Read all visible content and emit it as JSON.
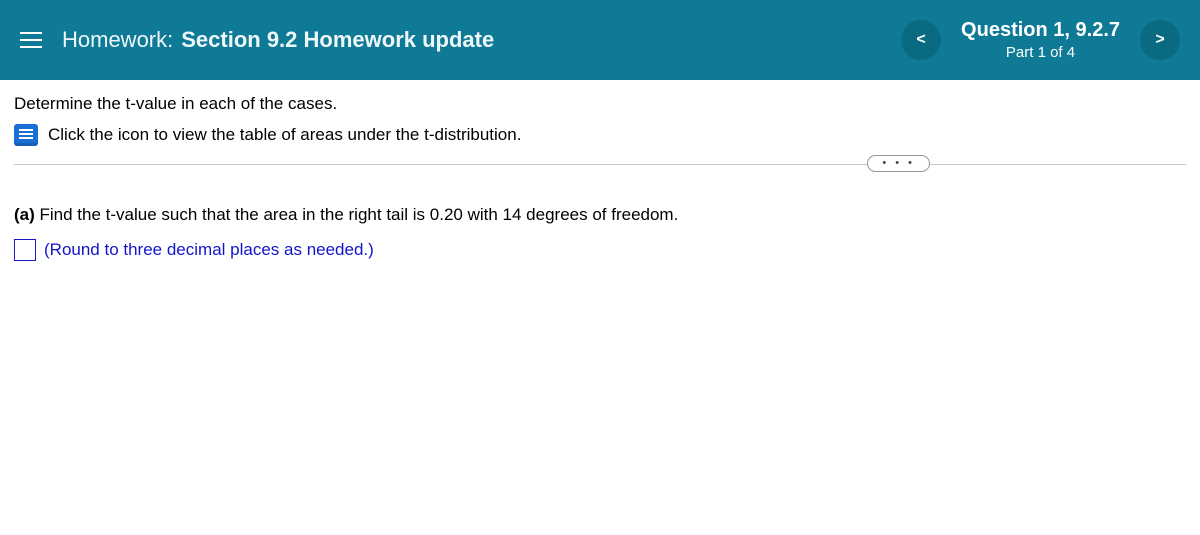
{
  "header": {
    "title_prefix": "Homework:",
    "title_main": "Section 9.2 Homework update",
    "question_title": "Question 1, 9.2.7",
    "question_sub": "Part 1 of 4",
    "prev_glyph": "<",
    "next_glyph": ">"
  },
  "content": {
    "prompt": "Determine the t-value in each of the cases.",
    "table_link": "Click the icon to view the table of areas under the t-distribution.",
    "ellipsis": "• • •",
    "part_a_label": "(a)",
    "part_a_text": " Find the t-value such that the area in the right tail is 0.20 with 14 degrees of freedom.",
    "round_note": "(Round to three decimal places as needed.)",
    "answer_value": ""
  }
}
